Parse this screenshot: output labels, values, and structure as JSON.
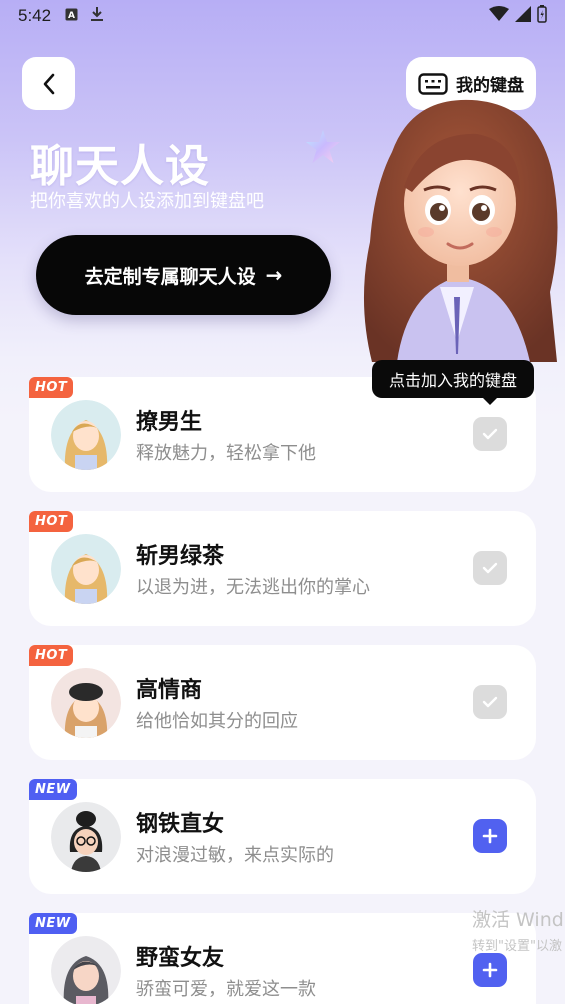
{
  "status_bar": {
    "time": "5:42",
    "icons": [
      "font-a-icon",
      "download-icon",
      "wifi-icon",
      "signal-icon",
      "battery-icon"
    ]
  },
  "header": {
    "keyboard_button_label": "我的键盘"
  },
  "hero": {
    "title": "聊天人设",
    "subtitle": "把你喜欢的人设添加到键盘吧",
    "cta_label": "去定制专属聊天人设",
    "cta_arrow": "→"
  },
  "tooltip": {
    "text": "点击加入我的键盘"
  },
  "personas": [
    {
      "badge": "HOT",
      "badge_type": "hot",
      "name": "撩男生",
      "desc": "释放魅力，轻松拿下他",
      "state": "added"
    },
    {
      "badge": "HOT",
      "badge_type": "hot",
      "name": "斩男绿茶",
      "desc": "以退为进，无法逃出你的掌心",
      "state": "added"
    },
    {
      "badge": "HOT",
      "badge_type": "hot",
      "name": "高情商",
      "desc": "给他恰如其分的回应",
      "state": "added"
    },
    {
      "badge": "NEW",
      "badge_type": "new",
      "name": "钢铁直女",
      "desc": "对浪漫过敏，来点实际的",
      "state": "add"
    },
    {
      "badge": "NEW",
      "badge_type": "new",
      "name": "野蛮女友",
      "desc": "骄蛮可爱，就爱这一款",
      "state": "add"
    }
  ],
  "watermark": {
    "line1": "激活 Wind",
    "line2": "转到\"设置\"以激"
  },
  "colors": {
    "hot_badge": "#f4633f",
    "new_badge": "#4f5ff2",
    "add_button": "#5161f0",
    "added_button": "#dcdcdc",
    "cta_background": "#070707"
  }
}
